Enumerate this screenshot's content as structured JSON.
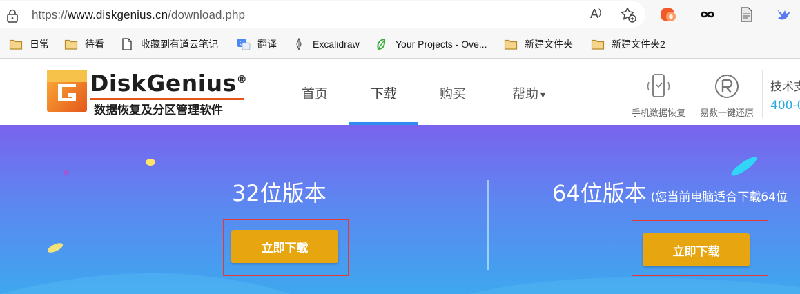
{
  "browser": {
    "url_prefix": "https://",
    "url_host": "www.diskgenius.cn",
    "url_path": "/download.php",
    "read_aloud_label": "A",
    "icons": [
      "lock-icon",
      "read-aloud-icon",
      "add-favorite-icon",
      "extension-icon",
      "infinity-icon",
      "reading-list-icon",
      "bird-extension-icon"
    ]
  },
  "bookmarks": [
    {
      "label": "日常",
      "icon": "folder-icon"
    },
    {
      "label": "待看",
      "icon": "folder-icon"
    },
    {
      "label": "收藏到有道云笔记",
      "icon": "page-icon"
    },
    {
      "label": "翻译",
      "icon": "translate-icon"
    },
    {
      "label": "Excalidraw",
      "icon": "excalidraw-icon"
    },
    {
      "label": "Your Projects - Ove...",
      "icon": "leaf-icon"
    },
    {
      "label": "新建文件夹",
      "icon": "folder-icon"
    },
    {
      "label": "新建文件夹2",
      "icon": "folder-icon"
    }
  ],
  "site": {
    "logo_name": "DiskGenius",
    "logo_registered": "®",
    "logo_tagline": "数据恢复及分区管理软件",
    "nav": [
      {
        "label": "首页"
      },
      {
        "label": "下载"
      },
      {
        "label": "购买"
      },
      {
        "label": "帮助"
      }
    ],
    "nav_dropdown_caret": "▾",
    "tools": [
      {
        "label": "手机数据恢复",
        "icon": "phone-recovery-icon"
      },
      {
        "label": "易数一键还原",
        "icon": "restore-icon"
      }
    ],
    "support_title": "技术支",
    "support_phone": "400-0"
  },
  "hero": {
    "left_title": "32位版本",
    "right_title": "64位版本",
    "right_note": "(您当前电脑适合下载64位",
    "left_button": "立即下载",
    "right_button": "立即下载"
  },
  "colors": {
    "accent_blue": "#2f8cf0",
    "button_orange": "#e7a50f",
    "highlight_red": "#e53935",
    "phone_cyan": "#2aa9e0"
  }
}
